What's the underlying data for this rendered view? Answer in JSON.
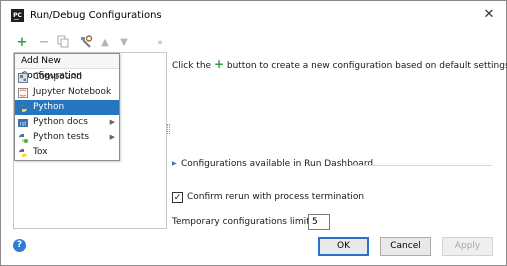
{
  "window": {
    "title": "Run/Debug Configurations",
    "app_icon_text": "PC",
    "close_symbol": "✕"
  },
  "toolbar": {
    "add_icon": "+",
    "remove_icon": "−",
    "copy_icon": "copy-icon",
    "edit_icon": "wrench-icon",
    "up_icon": "▲",
    "down_icon": "▼",
    "more_icon": "»"
  },
  "popup": {
    "title": "Add New Configuration",
    "items": [
      {
        "label": "Compound",
        "icon": "compound-icon",
        "submenu": false
      },
      {
        "label": "Jupyter Notebook",
        "icon": "jupyter-icon",
        "submenu": false
      },
      {
        "label": "Python",
        "icon": "python-icon",
        "submenu": false,
        "selected": true
      },
      {
        "label": "Python docs",
        "icon": "python-docs-icon",
        "submenu": true
      },
      {
        "label": "Python tests",
        "icon": "python-tests-icon",
        "submenu": true
      },
      {
        "label": "Tox",
        "icon": "tox-icon",
        "submenu": false
      }
    ],
    "submenu_arrow": "▶"
  },
  "main": {
    "hint_prefix": "Click the ",
    "hint_plus": "+",
    "hint_suffix": " button to create a new configuration based on default settings",
    "dashboard_label": "Configurations available in Run Dashboard",
    "dashboard_arrow": "▶",
    "confirm_rerun_label": "Confirm rerun with process termination",
    "confirm_rerun_checked": true,
    "check_mark": "✓",
    "limit_label": "Temporary configurations limit:",
    "limit_value": "5"
  },
  "footer": {
    "help_symbol": "?",
    "ok_label": "OK",
    "cancel_label": "Cancel",
    "apply_label": "Apply"
  },
  "colors": {
    "selection": "#2675bf",
    "add_green": "#2e9e43",
    "default_button_border": "#2a72c9"
  }
}
